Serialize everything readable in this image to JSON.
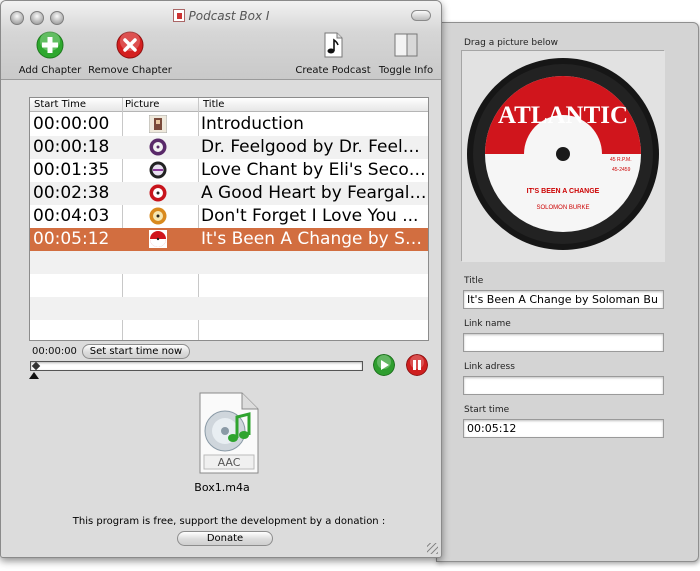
{
  "window": {
    "title": "Podcast Box I"
  },
  "toolbar": {
    "add_chapter": "Add Chapter",
    "remove_chapter": "Remove Chapter",
    "create_podcast": "Create Podcast",
    "toggle_info": "Toggle Info"
  },
  "table": {
    "headers": [
      "Start Time",
      "Picture",
      "Title"
    ],
    "rows": [
      {
        "time": "00:00:00",
        "title": "Introduction",
        "selected": false
      },
      {
        "time": "00:00:18",
        "title": "Dr. Feelgood by Dr. Feelgood",
        "selected": false
      },
      {
        "time": "00:01:35",
        "title": "Love Chant by Eli's Second Coming",
        "selected": false
      },
      {
        "time": "00:02:38",
        "title": "A Good Heart by Feargal Sharkey",
        "selected": false
      },
      {
        "time": "00:04:03",
        "title": "Don't Forget I Love You ...",
        "selected": false
      },
      {
        "time": "00:05:12",
        "title": "It's Been A Change by Soloman Burke",
        "selected": true
      }
    ]
  },
  "player": {
    "current_time": "00:00:00",
    "set_start_button": "Set start time now"
  },
  "file": {
    "name": "Box1.m4a",
    "badge": "AAC"
  },
  "footer": {
    "text": "This program is free, support the development by a donation :",
    "donate_button": "Donate"
  },
  "drawer": {
    "picture_label": "Drag a picture below",
    "title_label": "Title",
    "title_value": "It's Been A Change by Soloman Bu",
    "link_name_label": "Link name",
    "link_name_value": "",
    "link_address_label": "Link adress",
    "link_address_value": "",
    "start_time_label": "Start time",
    "start_time_value": "00:05:12"
  },
  "artwork": {
    "label_brand": "ATLANTIC",
    "song": "IT'S BEEN A CHANGE",
    "artist": "SOLOMON BURKE",
    "speed": "45 R.P.M.",
    "catalog": "45-2459"
  },
  "colors": {
    "selection": "#d26e40",
    "add": "#2ea82e",
    "remove": "#d42020",
    "label_red": "#d0151c"
  }
}
